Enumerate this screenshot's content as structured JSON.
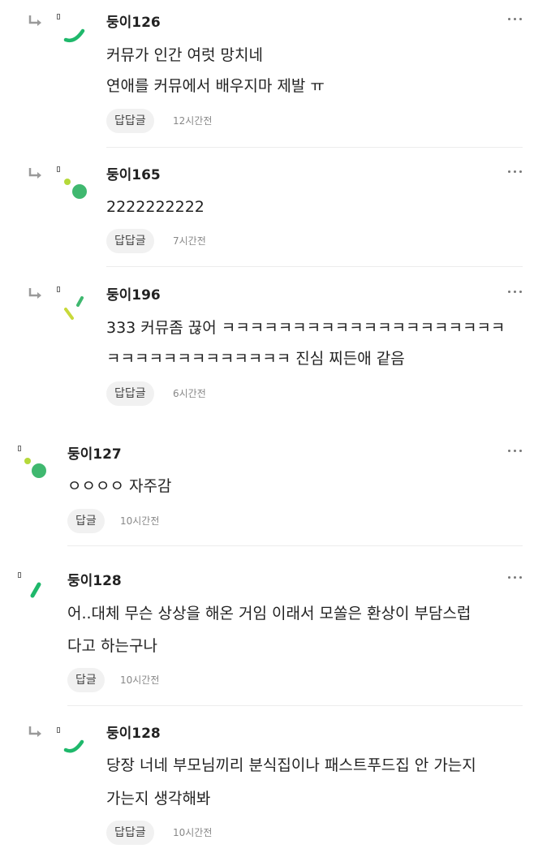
{
  "icons": {
    "reply_indicator": "reply-arrow-icon",
    "more_options": "more-options-icon",
    "report_flag": "flag-icon"
  },
  "comments": [
    {
      "nickname": "둥이126",
      "lines": [
        "커뮤가 인간 여럿 망치네",
        "연애를 커뮤에서 배우지마 제발 ㅠ"
      ],
      "reply_label": "답답글",
      "time": "12시간전",
      "avatar_color": "#1fb86b"
    },
    {
      "nickname": "둥이165",
      "lines": [
        "2222222222"
      ],
      "reply_label": "답답글",
      "time": "7시간전",
      "avatar_color": "#3fb86f"
    },
    {
      "nickname": "둥이196",
      "lines": [
        "333 커뮤좀 끊어 ㅋㅋㅋㅋㅋㅋㅋㅋㅋㅋㅋㅋㅋㅋㅋㅋㅋㅋㅋㅋ",
        "ㅋㅋㅋㅋㅋㅋㅋㅋㅋㅋㅋㅋㅋ 진심 찌든애 같음"
      ],
      "reply_label": "답답글",
      "time": "6시간전",
      "avatar_color": "#c8d93a"
    },
    {
      "nickname": "둥이127",
      "lines": [
        "ㅇㅇㅇㅇ 자주감"
      ],
      "reply_label": "답글",
      "time": "10시간전",
      "avatar_color": "#3fb86f"
    },
    {
      "nickname": "둥이128",
      "lines": [
        "어..대체 무슨 상상을 해온 거임 이래서 모쏠은 환상이 부담스럽",
        "다고 하는구나"
      ],
      "reply_label": "답글",
      "time": "10시간전",
      "avatar_color": "#1fb86b"
    },
    {
      "nickname": "둥이128",
      "lines": [
        "당장 너네 부모님끼리 분식집이나 패스트푸드집 안 가는지",
        "가는지 생각해봐"
      ],
      "reply_label": "답답글",
      "time": "10시간전",
      "avatar_color": "#1fb86b"
    }
  ]
}
